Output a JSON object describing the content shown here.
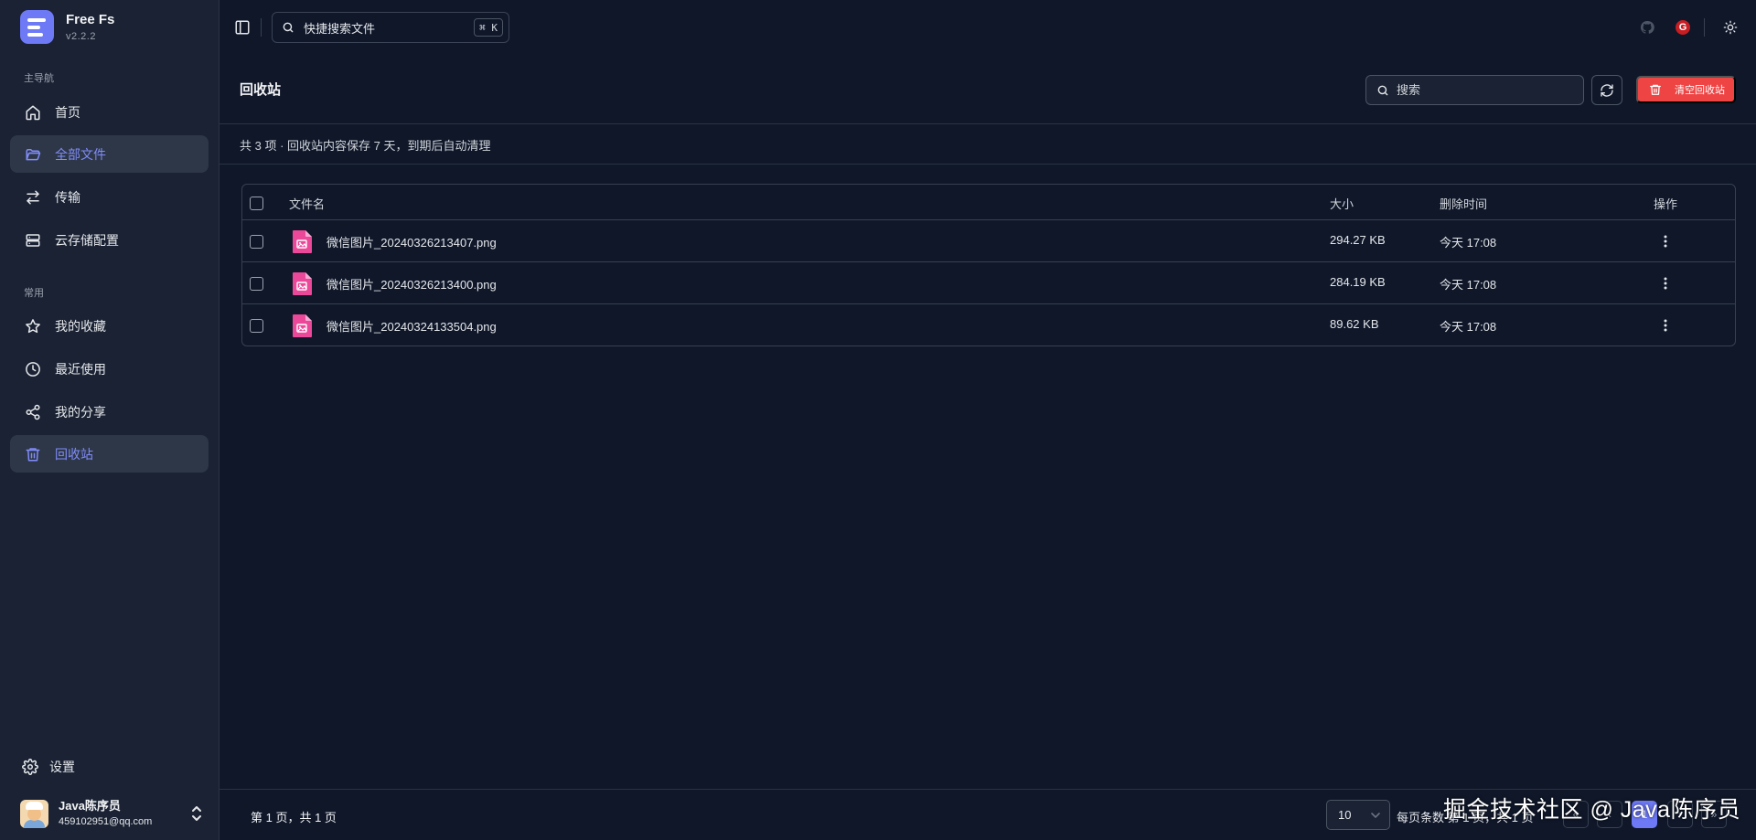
{
  "brand": {
    "name": "Free Fs",
    "version": "v2.2.2"
  },
  "sidebar": {
    "main_label": "主导航",
    "common_label": "常用",
    "main_items": [
      {
        "label": "首页",
        "icon": "home-icon",
        "active": false
      },
      {
        "label": "全部文件",
        "icon": "folder-icon",
        "active": true
      },
      {
        "label": "传输",
        "icon": "transfer-icon",
        "active": false
      },
      {
        "label": "云存储配置",
        "icon": "storage-icon",
        "active": false
      }
    ],
    "common_items": [
      {
        "label": "我的收藏",
        "icon": "star-icon",
        "active": false
      },
      {
        "label": "最近使用",
        "icon": "clock-icon",
        "active": false
      },
      {
        "label": "我的分享",
        "icon": "share-icon",
        "active": false
      },
      {
        "label": "回收站",
        "icon": "trash-icon",
        "active": true
      }
    ],
    "settings_label": "设置",
    "user": {
      "name": "Java陈序员",
      "email": "459102951@qq.com"
    }
  },
  "topbar": {
    "search_placeholder": "快捷搜索文件",
    "shortcut": "⌘ K",
    "gitee_letter": "G"
  },
  "page": {
    "title": "回收站",
    "search_placeholder": "搜索",
    "clear_label": "清空回收站",
    "info": "共 3 项 · 回收站内容保存 7 天，到期后自动清理"
  },
  "table": {
    "headers": {
      "name": "文件名",
      "size": "大小",
      "deleted": "删除时间",
      "actions": "操作"
    },
    "rows": [
      {
        "name": "微信图片_20240326213407.png",
        "size": "294.27 KB",
        "deleted": "今天 17:08"
      },
      {
        "name": "微信图片_20240326213400.png",
        "size": "284.19 KB",
        "deleted": "今天 17:08"
      },
      {
        "name": "微信图片_20240324133504.png",
        "size": "89.62 KB",
        "deleted": "今天 17:08"
      }
    ]
  },
  "footer": {
    "page_info": "第 1 页，共 1 页",
    "page_size": "10",
    "per_page_text": "每页条数 第 1 页，共 1 页",
    "current_page": "1"
  },
  "watermark": "掘金技术社区 @ Java陈序员",
  "colors": {
    "accent": "#6d79f5",
    "danger": "#ef4444",
    "background": "#0f1729",
    "sidebar": "#1a2233"
  }
}
